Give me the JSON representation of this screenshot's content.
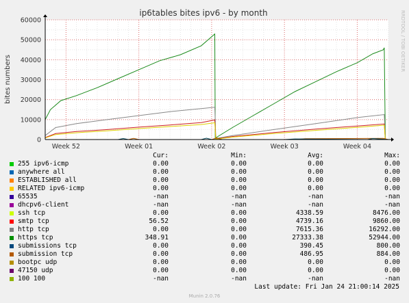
{
  "chart_data": {
    "type": "line",
    "title": "ip6tables bites ipv6 - by month",
    "ylabel": "bites numbers",
    "watermark": "RRDTOOL / TOBI OETIKER",
    "ylim": [
      0,
      60000
    ],
    "yticks": [
      0,
      10000,
      20000,
      30000,
      40000,
      50000,
      60000
    ],
    "ytick_labels": [
      "0",
      "10000",
      "20000",
      "30000",
      "40000",
      "50000",
      "60000"
    ],
    "xlim": [
      0,
      33
    ],
    "xticks": [
      {
        "x": 2,
        "label": "Week 52"
      },
      {
        "x": 9,
        "label": "Week 01"
      },
      {
        "x": 16,
        "label": "Week 02"
      },
      {
        "x": 23,
        "label": "Week 03"
      },
      {
        "x": 30,
        "label": "Week 04"
      }
    ],
    "grid": true,
    "colors": {
      "background": "#f0f0f0",
      "plot": "#ffffff",
      "minor_grid": "#e5e5e5",
      "major_grid": "#e07070",
      "axis": "#000000"
    },
    "series": [
      {
        "name": "https tcp",
        "color": "#1a8a1a",
        "x": [
          0,
          0.5,
          1.5,
          3,
          5,
          7,
          9,
          11,
          13,
          15,
          16.3,
          16.35,
          16.5,
          18,
          20,
          22,
          24,
          26,
          28,
          30,
          31.5,
          32.5,
          32.6,
          32.7
        ],
        "y": [
          10000,
          15000,
          19500,
          22000,
          26000,
          30500,
          35000,
          39500,
          42500,
          47000,
          52900,
          500,
          1200,
          6000,
          12000,
          18000,
          24000,
          29000,
          34000,
          38500,
          43000,
          45000,
          46000,
          1000
        ]
      },
      {
        "name": "http tcp",
        "color": "#888888",
        "x": [
          0,
          1,
          3,
          6,
          9,
          12,
          15,
          16.3,
          16.4,
          18,
          22,
          26,
          30,
          32.6,
          32.7
        ],
        "y": [
          2000,
          6000,
          8000,
          10000,
          12000,
          14000,
          15500,
          16200,
          500,
          2000,
          5000,
          8000,
          11000,
          12500,
          0
        ]
      },
      {
        "name": "smtp tcp",
        "color": "#cc1f1f",
        "x": [
          0,
          1,
          3,
          6,
          9,
          12,
          15,
          16.3,
          16.4,
          18,
          22,
          26,
          30,
          32.6,
          32.7
        ],
        "y": [
          1000,
          3000,
          4000,
          5000,
          6200,
          7300,
          8500,
          9800,
          300,
          1500,
          3500,
          5200,
          6800,
          7800,
          0
        ]
      },
      {
        "name": "ssh tcp",
        "color": "#e0d000",
        "x": [
          0,
          1,
          3,
          6,
          9,
          12,
          15,
          16.3,
          16.4,
          18,
          22,
          26,
          30,
          32.6,
          32.7
        ],
        "y": [
          800,
          2500,
          3400,
          4400,
          5500,
          6500,
          7500,
          8400,
          200,
          1200,
          3000,
          4600,
          6100,
          7200,
          0
        ]
      },
      {
        "name": "submission tcp",
        "color": "#b35a00",
        "x": [
          0,
          8,
          8.5,
          9,
          16,
          16.5,
          17,
          24,
          25,
          32.5,
          33
        ],
        "y": [
          0,
          0,
          600,
          0,
          0,
          800,
          0,
          0,
          400,
          600,
          0
        ]
      },
      {
        "name": "submissions tcp",
        "color": "#0a4a5a",
        "x": [
          0,
          7,
          7.5,
          8,
          15,
          15.5,
          16,
          23,
          24,
          31,
          31.5,
          33
        ],
        "y": [
          0,
          0,
          500,
          0,
          0,
          700,
          0,
          0,
          300,
          0,
          500,
          0
        ]
      }
    ]
  },
  "legend": {
    "headers": {
      "cur": "Cur:",
      "min": "Min:",
      "avg": "Avg:",
      "max": "Max:"
    },
    "rows": [
      {
        "name": "255 ipv6-icmp",
        "color": "#00cc00",
        "cur": "0.00",
        "min": "0.00",
        "avg": "0.00",
        "max": "0.00"
      },
      {
        "name": "anywhere all",
        "color": "#0066b3",
        "cur": "0.00",
        "min": "0.00",
        "avg": "0.00",
        "max": "0.00"
      },
      {
        "name": "ESTABLISHED all",
        "color": "#ff8000",
        "cur": "0.00",
        "min": "0.00",
        "avg": "0.00",
        "max": "0.00"
      },
      {
        "name": "RELATED ipv6-icmp",
        "color": "#ffcc00",
        "cur": "0.00",
        "min": "0.00",
        "avg": "0.00",
        "max": "0.00"
      },
      {
        "name": "65535",
        "color": "#330099",
        "cur": "-nan",
        "min": "-nan",
        "avg": "-nan",
        "max": "-nan"
      },
      {
        "name": "dhcpv6-client",
        "color": "#990099",
        "cur": "-nan",
        "min": "-nan",
        "avg": "-nan",
        "max": "-nan"
      },
      {
        "name": "ssh tcp",
        "color": "#ccff00",
        "cur": "0.00",
        "min": "0.00",
        "avg": "4338.59",
        "max": "8476.00"
      },
      {
        "name": "smtp tcp",
        "color": "#ff0000",
        "cur": "56.52",
        "min": "0.00",
        "avg": "4739.16",
        "max": "9860.00"
      },
      {
        "name": "http tcp",
        "color": "#808080",
        "cur": "0.00",
        "min": "0.00",
        "avg": "7615.36",
        "max": "16292.00"
      },
      {
        "name": "https tcp",
        "color": "#008f00",
        "cur": "348.91",
        "min": "0.00",
        "avg": "27333.38",
        "max": "52944.00"
      },
      {
        "name": "submissions tcp",
        "color": "#00487d",
        "cur": "0.00",
        "min": "0.00",
        "avg": "390.45",
        "max": "800.00"
      },
      {
        "name": "submission tcp",
        "color": "#b35a00",
        "cur": "0.00",
        "min": "0.00",
        "avg": "486.95",
        "max": "884.00"
      },
      {
        "name": "bootpc udp",
        "color": "#b38f00",
        "cur": "0.00",
        "min": "0.00",
        "avg": "0.00",
        "max": "0.00"
      },
      {
        "name": "47150 udp",
        "color": "#6b006b",
        "cur": "0.00",
        "min": "0.00",
        "avg": "0.00",
        "max": "0.00"
      },
      {
        "name": "100 100",
        "color": "#8fb300",
        "cur": "-nan",
        "min": "-nan",
        "avg": "-nan",
        "max": "-nan"
      }
    ]
  },
  "last_update": "Last update: Fri Jan 24 21:00:14 2025",
  "footer": "Munin 2.0.76"
}
